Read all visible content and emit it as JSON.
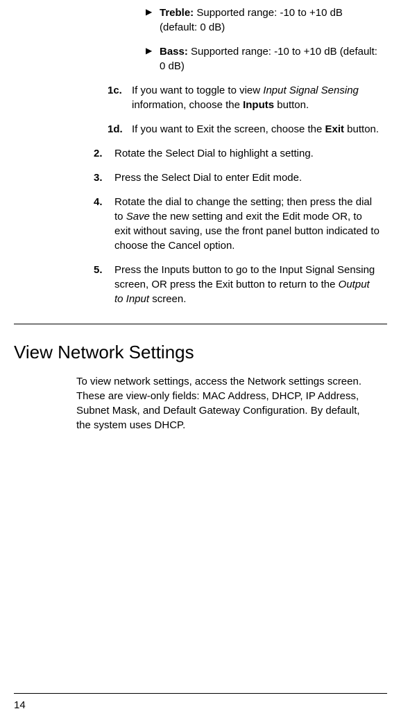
{
  "bullets": [
    {
      "label": "Treble:",
      "text": " Supported range: -10 to +10 dB (default: 0 dB)"
    },
    {
      "label": "Bass:",
      "text": " Supported range: -10 to +10 dB (default: 0 dB)"
    }
  ],
  "substeps": [
    {
      "num": "1c.",
      "pre": "If you want to toggle to view ",
      "italic": "Input Signal Sensing",
      "mid": " information, choose the ",
      "bold": "Inputs",
      "post": " button."
    },
    {
      "num": "1d.",
      "pre": "If you want to Exit the screen, choose the ",
      "italic": "",
      "mid": "",
      "bold": "Exit",
      "post": " button."
    }
  ],
  "steps": [
    {
      "num": "2.",
      "text": "Rotate the Select Dial to highlight a setting."
    },
    {
      "num": "3.",
      "text": "Press the Select Dial to enter Edit mode."
    },
    {
      "num": "4.",
      "pre": "Rotate the dial to change the setting; then press the dial to ",
      "italic": "Save",
      "post": " the new setting and exit the Edit mode OR, to exit without saving, use the front panel button indicated to choose the Cancel option."
    },
    {
      "num": "5.",
      "pre": "Press the Inputs button to go to the Input Signal Sensing screen, OR press the Exit button to return to the ",
      "italic": "Output to Input",
      "post": " screen."
    }
  ],
  "section": {
    "heading": "View Network Settings",
    "body": "To view network settings, access the Network settings screen. These are view-only fields: MAC Address, DHCP, IP Address, Subnet Mask, and Default Gateway Configuration. By default, the system uses DHCP."
  },
  "pageNumber": "14"
}
